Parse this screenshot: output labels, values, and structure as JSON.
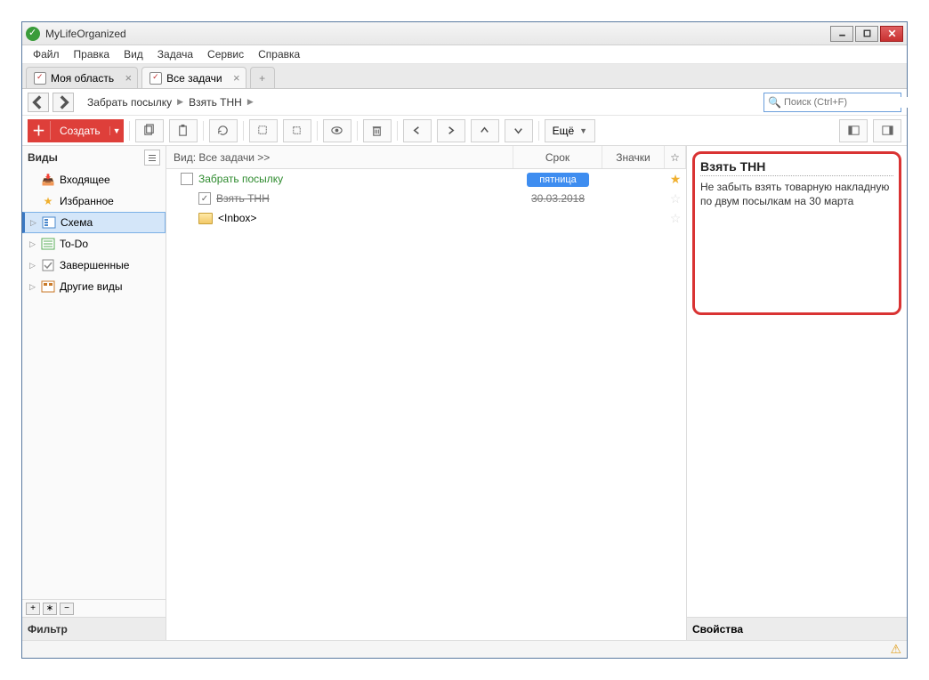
{
  "app": {
    "title": "MyLifeOrganized"
  },
  "menu": [
    "Файл",
    "Правка",
    "Вид",
    "Задача",
    "Сервис",
    "Справка"
  ],
  "tabs": [
    {
      "label": "Моя область",
      "active": false
    },
    {
      "label": "Все задачи",
      "active": true
    }
  ],
  "breadcrumb": [
    "Забрать посылку",
    "Взять ТНН"
  ],
  "search": {
    "placeholder": "Поиск (Ctrl+F)"
  },
  "toolbar": {
    "create": "Создать",
    "more": "Ещё"
  },
  "sidebar": {
    "title": "Виды",
    "items": [
      {
        "label": "Входящее",
        "icon": "inbox"
      },
      {
        "label": "Избранное",
        "icon": "star"
      },
      {
        "label": "Схема",
        "icon": "schema",
        "selected": true
      },
      {
        "label": "To-Do",
        "icon": "todo"
      },
      {
        "label": "Завершенные",
        "icon": "done"
      },
      {
        "label": "Другие виды",
        "icon": "other"
      }
    ],
    "filter": "Фильтр"
  },
  "list": {
    "header": {
      "vid": "Вид: Все задачи >>",
      "srok": "Срок",
      "znach": "Значки"
    },
    "rows": [
      {
        "name": "Забрать посылку",
        "due_pill": "пятница",
        "starred": true,
        "style": "green",
        "expanded": true
      },
      {
        "name": "Взять ТНН",
        "due": "30.03.2018",
        "starred": false,
        "style": "strike",
        "checked": true,
        "child": true
      },
      {
        "name": "<Inbox>",
        "folder": true,
        "starred": false,
        "child": true
      }
    ]
  },
  "detail": {
    "title": "Взять ТНН",
    "body": "Не забыть взять товарную накладную по двум посылкам на 30 марта",
    "props": "Свойства"
  }
}
